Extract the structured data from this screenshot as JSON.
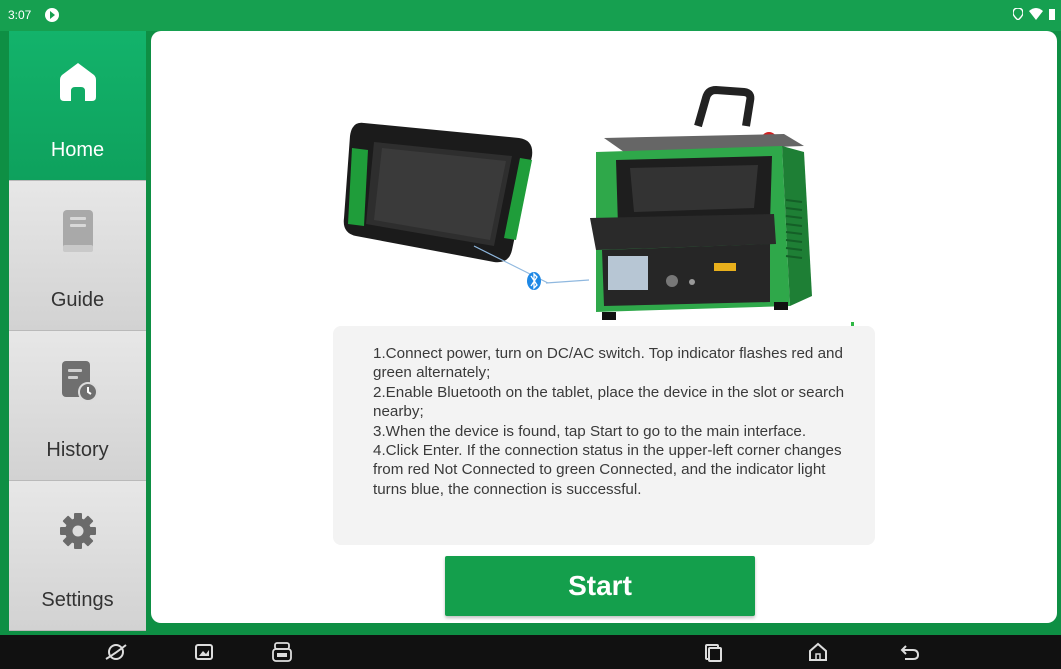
{
  "status_bar": {
    "time": "3:07"
  },
  "sidebar": {
    "items": [
      {
        "label": "Home",
        "icon": "home-icon",
        "active": true
      },
      {
        "label": "Guide",
        "icon": "book-icon",
        "active": false
      },
      {
        "label": "History",
        "icon": "history-icon",
        "active": false
      },
      {
        "label": "Settings",
        "icon": "gear-icon",
        "active": false
      }
    ]
  },
  "main": {
    "instructions": [
      "1.Connect power, turn on DC/AC switch. Top indicator flashes red and green alternately;",
      "2.Enable Bluetooth on the tablet, place the device in the slot or search nearby;",
      "3.When the device is found, tap Start to go to the main interface.",
      "4.Click Enter. If the connection status in the upper-left corner changes from red Not Connected to green Connected, and the indicator light turns blue, the connection is successful."
    ],
    "start_label": "Start"
  },
  "colors": {
    "accent": "#149f4c",
    "active_nav": "#13b36b",
    "status_bar": "#16a050",
    "bluetooth": "#1e88e5"
  }
}
